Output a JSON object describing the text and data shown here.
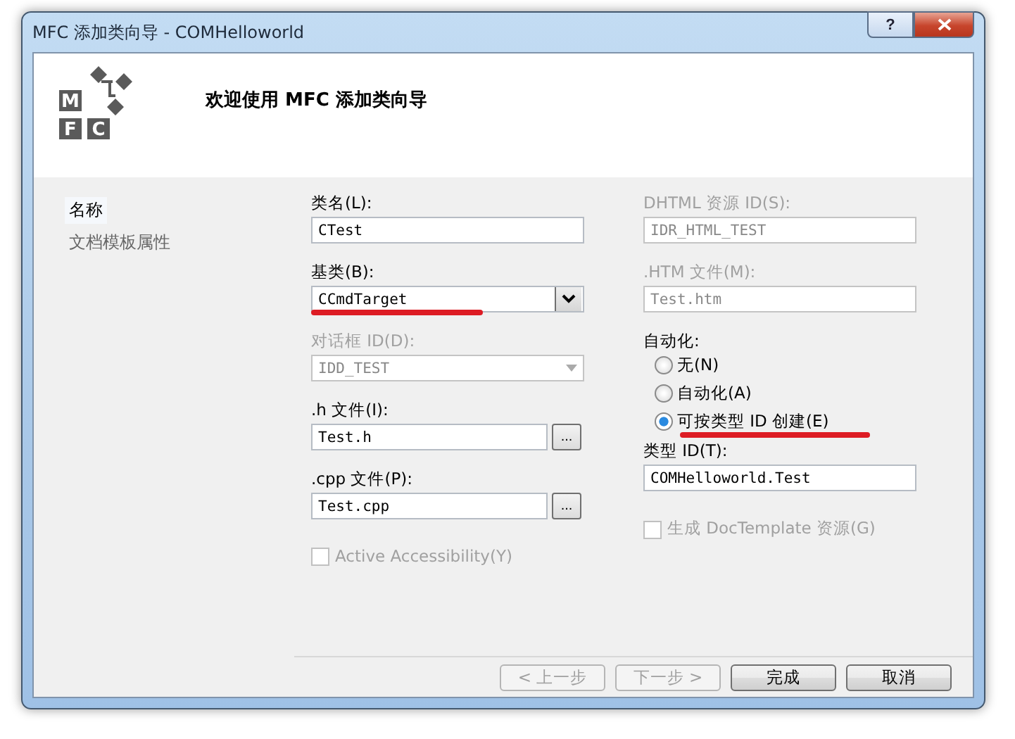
{
  "window": {
    "title": "MFC 添加类向导 - COMHelloworld",
    "help": "?"
  },
  "header": {
    "logo": [
      "M",
      "F",
      "C"
    ],
    "title": "欢迎使用 MFC 添加类向导"
  },
  "sidebar": {
    "items": [
      {
        "label": "名称",
        "selected": true
      },
      {
        "label": "文档模板属性",
        "selected": false
      }
    ]
  },
  "left": [
    {
      "kind": "text",
      "label": "类名(L):",
      "value": "CTest",
      "disabled": false
    },
    {
      "kind": "combo",
      "label": "基类(B):",
      "value": "CCmdTarget",
      "disabled": false,
      "marked": true
    },
    {
      "kind": "combo",
      "label": "对话框 ID(D):",
      "value": "IDD_TEST",
      "disabled": true,
      "marked": false
    },
    {
      "kind": "file",
      "label": ".h 文件(I):",
      "value": "Test.h",
      "button": "...",
      "disabled": false
    },
    {
      "kind": "file",
      "label": ".cpp 文件(P):",
      "value": "Test.cpp",
      "button": "...",
      "disabled": false
    },
    {
      "kind": "checkbox",
      "label": "Active Accessibility(Y)",
      "checked": false,
      "disabled": true
    }
  ],
  "right": [
    {
      "kind": "text",
      "label": "DHTML 资源 ID(S):",
      "value": "IDR_HTML_TEST",
      "disabled": true
    },
    {
      "kind": "text",
      "label": ".HTM 文件(M):",
      "value": "Test.htm",
      "disabled": true
    },
    {
      "kind": "radio-group",
      "label": "自动化:",
      "options": [
        {
          "label": "无(N)",
          "selected": false,
          "marked": false
        },
        {
          "label": "自动化(A)",
          "selected": false,
          "marked": false
        },
        {
          "label": "可按类型 ID 创建(E)",
          "selected": true,
          "marked": true
        }
      ]
    },
    {
      "kind": "text",
      "label": "类型 ID(T):",
      "value": "COMHelloworld.Test",
      "disabled": false
    },
    {
      "kind": "checkbox",
      "label": "生成 DocTemplate 资源(G)",
      "checked": false,
      "disabled": true
    }
  ],
  "buttons": [
    {
      "label": "< 上一步",
      "disabled": true
    },
    {
      "label": "下一步 >",
      "disabled": true
    },
    {
      "label": "完成",
      "disabled": false
    },
    {
      "label": "取消",
      "disabled": false
    }
  ]
}
